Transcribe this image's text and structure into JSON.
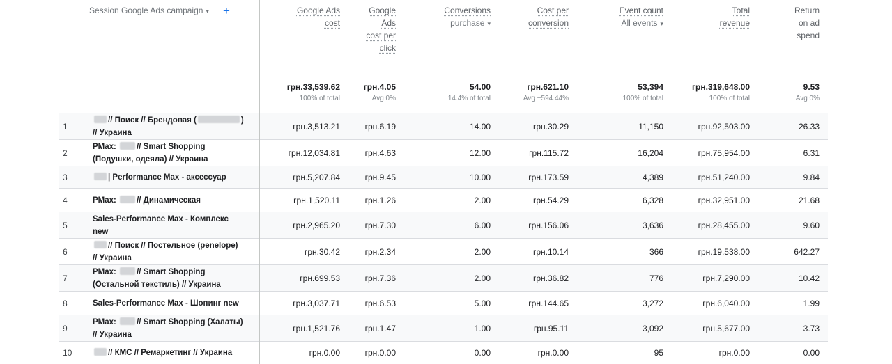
{
  "header": {
    "dimension_label": "Session Google Ads campaign",
    "dimension_chevron": "▾",
    "add_icon": "+",
    "sort_icon": "↓",
    "metrics": [
      {
        "title": "Google Ads cost",
        "sub": ""
      },
      {
        "title": "Google Ads cost per click",
        "sub": ""
      },
      {
        "title": "Conversions",
        "sub": "purchase"
      },
      {
        "title": "Cost per conversion",
        "sub": ""
      },
      {
        "title": "Event count",
        "sub": "All events"
      },
      {
        "title": "Total revenue",
        "sub": ""
      },
      {
        "title": "Return on ad spend",
        "sub": ""
      }
    ]
  },
  "totals": [
    {
      "value": "грн.33,539.62",
      "sub": "100% of total"
    },
    {
      "value": "грн.4.05",
      "sub": "Avg 0%"
    },
    {
      "value": "54.00",
      "sub": "14.4% of total"
    },
    {
      "value": "грн.621.10",
      "sub": "Avg +594.44%"
    },
    {
      "value": "53,394",
      "sub": "100% of total"
    },
    {
      "value": "грн.319,648.00",
      "sub": "100% of total"
    },
    {
      "value": "9.53",
      "sub": "Avg 0%"
    }
  ],
  "rows": [
    {
      "rank": "1",
      "pre": "",
      "l1": "// Поиск // Брендовая (",
      "l1b": ")",
      "l2": "// Украина",
      "values": [
        "грн.3,513.21",
        "грн.6.19",
        "14.00",
        "грн.30.29",
        "11,150",
        "грн.92,503.00",
        "26.33"
      ]
    },
    {
      "rank": "2",
      "pre": "PMax: ",
      "l1": "// Smart Shopping",
      "l1b": "",
      "l2": "(Подушки, одеяла) // Украина",
      "values": [
        "грн.12,034.81",
        "грн.4.63",
        "12.00",
        "грн.115.72",
        "16,204",
        "грн.75,954.00",
        "6.31"
      ]
    },
    {
      "rank": "3",
      "pre": "",
      "l1": "| Performance Max - аксессуар",
      "l1b": "",
      "l2": "",
      "values": [
        "грн.5,207.84",
        "грн.9.45",
        "10.00",
        "грн.173.59",
        "4,389",
        "грн.51,240.00",
        "9.84"
      ]
    },
    {
      "rank": "4",
      "pre": "PMax: ",
      "l1": "// Динамическая",
      "l1b": "",
      "l2": "",
      "values": [
        "грн.1,520.11",
        "грн.1.26",
        "2.00",
        "грн.54.29",
        "6,328",
        "грн.32,951.00",
        "21.68"
      ]
    },
    {
      "rank": "5",
      "pre": "",
      "l1": "Sales-Performance Max - Комплекс",
      "l1b": "",
      "l2": "new",
      "values": [
        "грн.2,965.20",
        "грн.7.30",
        "6.00",
        "грн.156.06",
        "3,636",
        "грн.28,455.00",
        "9.60"
      ]
    },
    {
      "rank": "6",
      "pre": "",
      "l1": "// Поиск // Постельное (penelope)",
      "l1b": "",
      "l2": "// Украина",
      "values": [
        "грн.30.42",
        "грн.2.34",
        "2.00",
        "грн.10.14",
        "366",
        "грн.19,538.00",
        "642.27"
      ]
    },
    {
      "rank": "7",
      "pre": "PMax: ",
      "l1": "// Smart Shopping",
      "l1b": "",
      "l2": "(Остальной текстиль) // Украина",
      "values": [
        "грн.699.53",
        "грн.7.36",
        "2.00",
        "грн.36.82",
        "776",
        "грн.7,290.00",
        "10.42"
      ]
    },
    {
      "rank": "8",
      "pre": "",
      "l1": "Sales-Performance Max - Шопинг new",
      "l1b": "",
      "l2": "",
      "values": [
        "грн.3,037.71",
        "грн.6.53",
        "5.00",
        "грн.144.65",
        "3,272",
        "грн.6,040.00",
        "1.99"
      ]
    },
    {
      "rank": "9",
      "pre": "PMax: ",
      "l1": "// Smart Shopping (Халаты)",
      "l1b": "",
      "l2": "// Украина",
      "values": [
        "грн.1,521.76",
        "грн.1.47",
        "1.00",
        "грн.95.11",
        "3,092",
        "грн.5,677.00",
        "3.73"
      ]
    },
    {
      "rank": "10",
      "pre": "",
      "l1": "// КМС // Ремаркетинг // Украина",
      "l1b": "",
      "l2": "",
      "values": [
        "грн.0.00",
        "грн.0.00",
        "0.00",
        "грн.0.00",
        "95",
        "грн.0.00",
        "0.00"
      ]
    }
  ]
}
